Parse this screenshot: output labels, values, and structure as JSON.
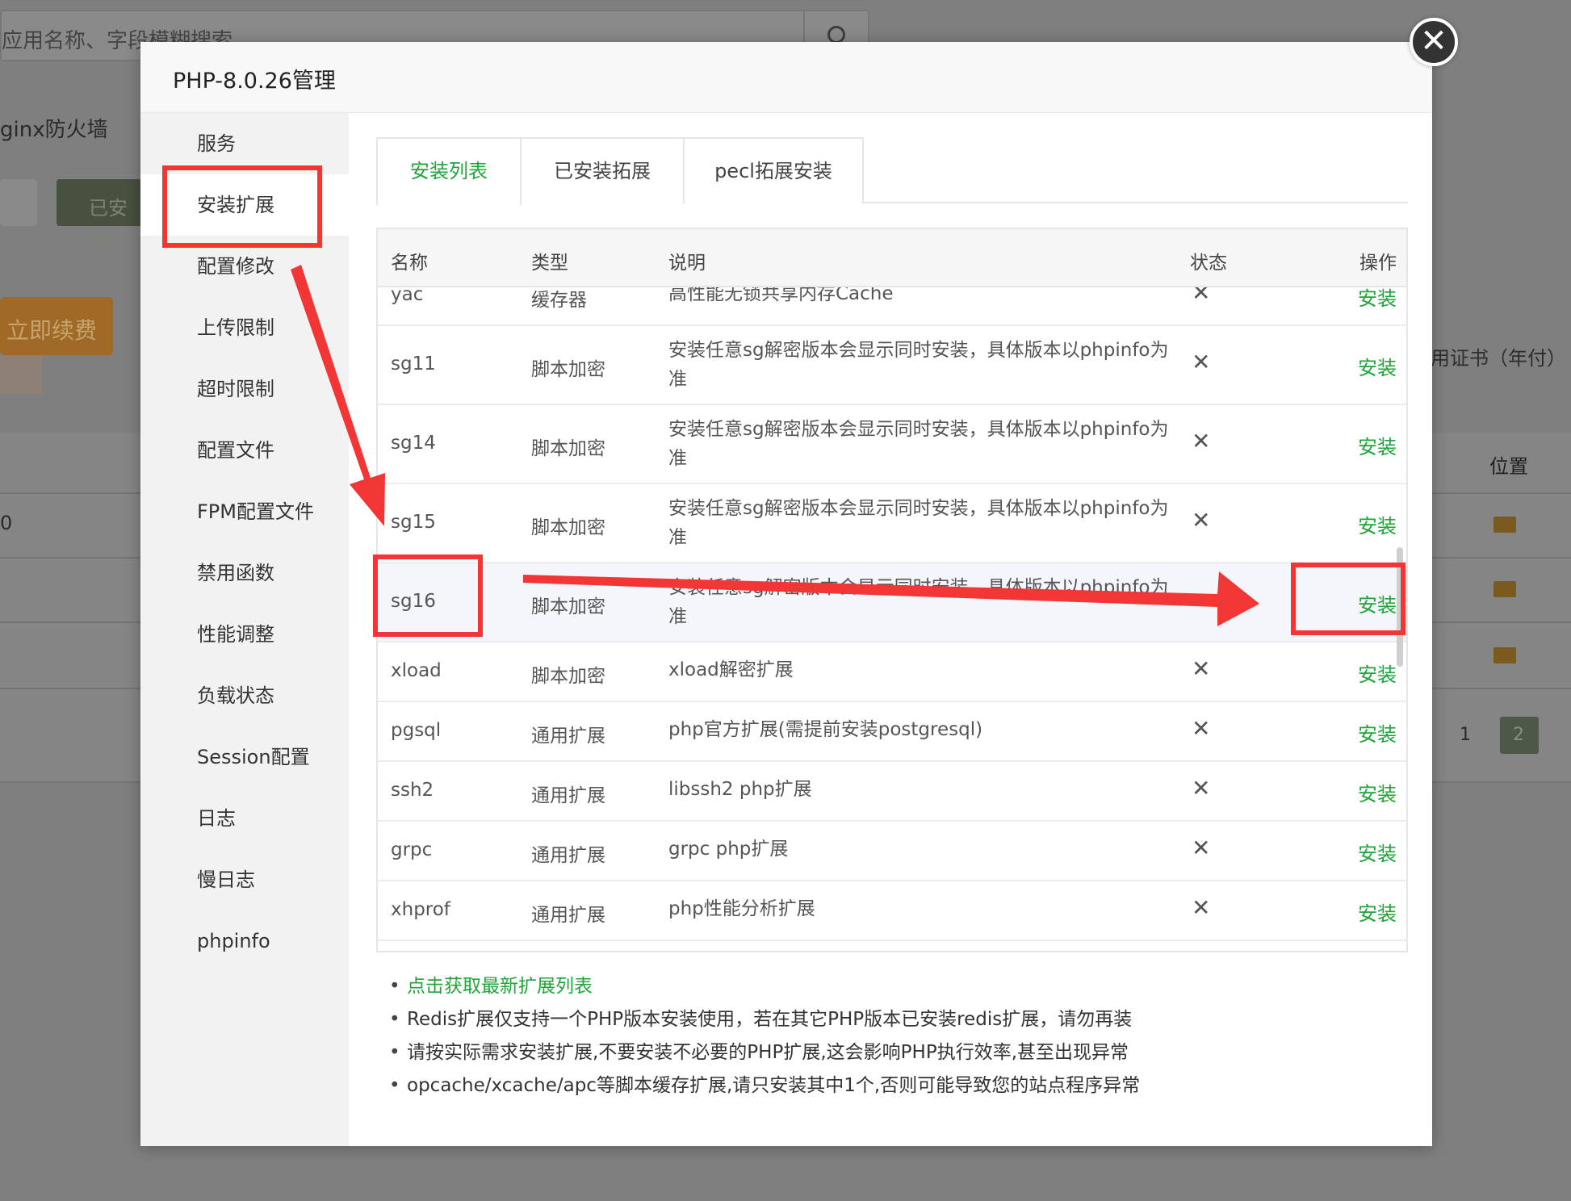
{
  "background": {
    "search_placeholder": "应用名称、字段模糊搜索",
    "firewall_label": "ginx防火墙",
    "installed_button": "已安装",
    "grey_button": "",
    "renew_button": "立即续费",
    "cert_text": "用证书（年付）",
    "position_header": "位置",
    "row_value": "0",
    "pagination": [
      "1",
      "2"
    ]
  },
  "modal": {
    "title": "PHP-8.0.26管理",
    "close_icon": "close-icon"
  },
  "sidebar": {
    "items": [
      {
        "label": "服务"
      },
      {
        "label": "安装扩展"
      },
      {
        "label": "配置修改"
      },
      {
        "label": "上传限制"
      },
      {
        "label": "超时限制"
      },
      {
        "label": "配置文件"
      },
      {
        "label": "FPM配置文件"
      },
      {
        "label": "禁用函数"
      },
      {
        "label": "性能调整"
      },
      {
        "label": "负载状态"
      },
      {
        "label": "Session配置"
      },
      {
        "label": "日志"
      },
      {
        "label": "慢日志"
      },
      {
        "label": "phpinfo"
      }
    ],
    "active_index": 1
  },
  "tabs": [
    {
      "label": "安装列表"
    },
    {
      "label": "已安装拓展"
    },
    {
      "label": "pecl拓展安装"
    }
  ],
  "table": {
    "headers": {
      "name": "名称",
      "type": "类型",
      "desc": "说明",
      "status": "状态",
      "op": "操作"
    },
    "rows": [
      {
        "name": "yac",
        "type": "缓存器",
        "desc": "高性能无锁共享内存Cache",
        "status": "✕",
        "op": "安装"
      },
      {
        "name": "sg11",
        "type": "脚本加密",
        "desc": "安装任意sg解密版本会显示同时安装，具体版本以phpinfo为准",
        "status": "✕",
        "op": "安装"
      },
      {
        "name": "sg14",
        "type": "脚本加密",
        "desc": "安装任意sg解密版本会显示同时安装，具体版本以phpinfo为准",
        "status": "✕",
        "op": "安装"
      },
      {
        "name": "sg15",
        "type": "脚本加密",
        "desc": "安装任意sg解密版本会显示同时安装，具体版本以phpinfo为准",
        "status": "✕",
        "op": "安装"
      },
      {
        "name": "sg16",
        "type": "脚本加密",
        "desc": "安装任意sg解密版本会显示同时安装，具体版本以phpinfo为准",
        "status": "",
        "op": "安装"
      },
      {
        "name": "xload",
        "type": "脚本加密",
        "desc": "xload解密扩展",
        "status": "✕",
        "op": "安装"
      },
      {
        "name": "pgsql",
        "type": "通用扩展",
        "desc": "php官方扩展(需提前安装postgresql)",
        "status": "✕",
        "op": "安装"
      },
      {
        "name": "ssh2",
        "type": "通用扩展",
        "desc": "libssh2 php扩展",
        "status": "✕",
        "op": "安装"
      },
      {
        "name": "grpc",
        "type": "通用扩展",
        "desc": "grpc php扩展",
        "status": "✕",
        "op": "安装"
      },
      {
        "name": "xhprof",
        "type": "通用扩展",
        "desc": "php性能分析扩展",
        "status": "✕",
        "op": "安装"
      }
    ]
  },
  "notes": [
    {
      "text": "点击获取最新扩展列表",
      "link": true
    },
    {
      "text": "Redis扩展仅支持一个PHP版本安装使用，若在其它PHP版本已安装redis扩展，请勿再装",
      "link": false
    },
    {
      "text": "请按实际需求安装扩展,不要安装不必要的PHP扩展,这会影响PHP执行效率,甚至出现异常",
      "link": false
    },
    {
      "text": "opcache/xcache/apc等脚本缓存扩展,请只安装其中1个,否则可能导致您的站点程序异常",
      "link": false
    }
  ],
  "colors": {
    "accent_green": "#20a53a",
    "annotation_red": "#f23535"
  }
}
